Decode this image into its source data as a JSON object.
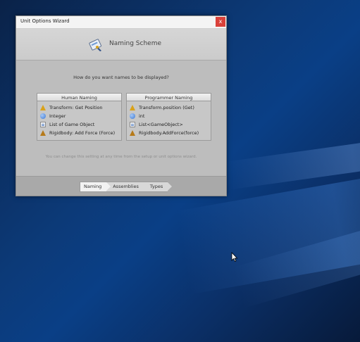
{
  "window": {
    "title": "Unit Options Wizard",
    "close_glyph": "x"
  },
  "header": {
    "title": "Naming Scheme",
    "icon": "naming-scheme-icon"
  },
  "question": "How do you want names to be displayed?",
  "human": {
    "label": "Human Naming",
    "rows": [
      {
        "icon": "transform-icon",
        "text": "Transform: Get Position"
      },
      {
        "icon": "integer-icon",
        "text": "Integer"
      },
      {
        "icon": "list-icon",
        "text": "List of Game Object"
      },
      {
        "icon": "rigidbody-icon",
        "text": "Rigidbody: Add Force (Force)"
      }
    ]
  },
  "programmer": {
    "label": "Programmer Naming",
    "rows": [
      {
        "icon": "transform-icon",
        "text": "Transform.position (Get)"
      },
      {
        "icon": "integer-icon",
        "text": "int"
      },
      {
        "icon": "list-icon",
        "text": "List<GameObject>"
      },
      {
        "icon": "rigidbody-icon",
        "text": "Rigidbody.AddForce(force)"
      }
    ]
  },
  "hint": "You can change this setting at any time from the setup or unit options wizard.",
  "breadcrumbs": [
    "Naming",
    "Assemblies",
    "Types"
  ],
  "active_breadcrumb": "Naming"
}
